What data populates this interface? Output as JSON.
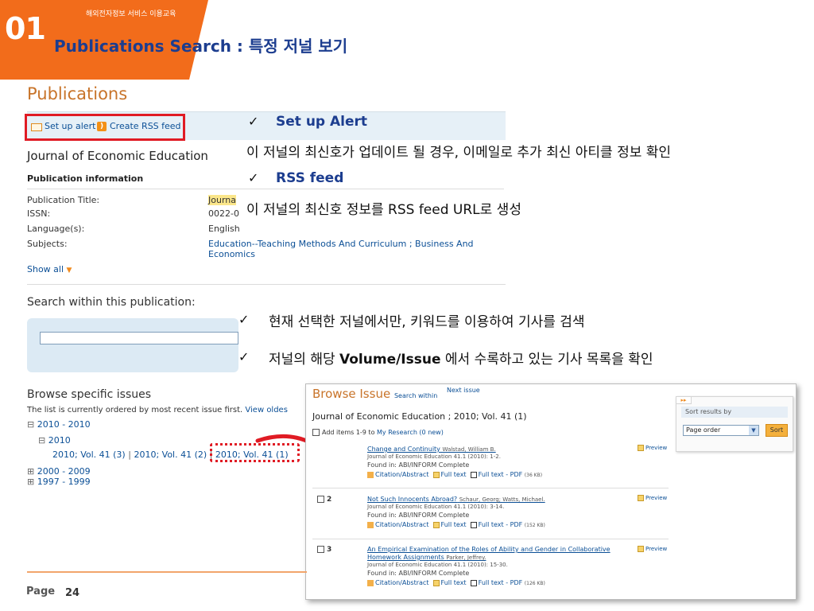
{
  "slide": {
    "section_number": "01",
    "section_small": "해외전자정보 서비스 이용교육",
    "title": "Publications Search : 특정 저널 보기",
    "page_label": "Page",
    "page_number": "24",
    "accent_color": "#f26c1b",
    "title_color": "#1c3d8f"
  },
  "publications": {
    "heading": "Publications",
    "toolbar": {
      "alert_label": "Set up alert",
      "rss_label": "Create RSS feed"
    },
    "journal_title": "Journal of Economic Education",
    "info_heading": "Publication information",
    "info": [
      {
        "label": "Publication Title:",
        "value": "Journa"
      },
      {
        "label": "ISSN:",
        "value": "0022-0"
      },
      {
        "label": "Language(s):",
        "value": "English"
      },
      {
        "label": "Subjects:",
        "value": "Education--Teaching Methods And Curriculum ; Business And Economics"
      }
    ],
    "show_all": "Show all",
    "search_heading": "Search within this publication:",
    "browse_heading": "Browse specific issues",
    "order_text": "The list is currently ordered by most recent issue first.",
    "order_link": "View oldes",
    "tree": {
      "range_2010": "2010 - 2010",
      "year_2010": "2010",
      "issue_a": "2010; Vol. 41 (3)",
      "issue_b": "2010; Vol. 41 (2)",
      "issue_c": "2010; Vol. 41 (1)",
      "range_2000": "2000 - 2009",
      "range_1997": "1997 - 1999"
    }
  },
  "annotations": {
    "check": "✓",
    "alert_title": "Set up Alert",
    "alert_desc": "이 저널의 최신호가 업데이트 될 경우, 이메일로 추가 최신 아티클 정보 확인",
    "rss_title": "RSS feed",
    "rss_desc": "이 저널의 최신호 정보를 RSS feed URL로 생성",
    "search_note": "현재 선택한 저널에서만, 키워드를 이용하여 기사를 검색",
    "volume_note_pre": "저널의 해당 ",
    "volume_note_bold": "Volume/Issue",
    "volume_note_post": " 에서 수록하고 있는 기사 목록을 확인"
  },
  "browse_issue": {
    "title": "Browse Issue",
    "search_within": "Search within",
    "next_issue": "Next issue",
    "journal_line": "Journal of Economic Education ; 2010; Vol. 41 (1)",
    "add_items_pre": "Add items 1-9 to",
    "add_items_link": "My Research (0 new)",
    "preview_label": "Preview",
    "found_in": "Found in: ABI/INFORM Complete",
    "citation_label": "Citation/Abstract",
    "fulltext_label": "Full text",
    "pdf_label": "Full text - PDF",
    "articles": [
      {
        "num": "",
        "title": "Change and Continuity",
        "author": "Walstad, William B.",
        "source": "Journal of Economic Education 41.1 (2010): 1-2.",
        "pdf_size": "(36 KB)"
      },
      {
        "num": "2",
        "title": "Not Such Innocents Abroad?",
        "author": "Schaur, Georg; Watts, Michael.",
        "source": "Journal of Economic Education 41.1 (2010): 3-14.",
        "pdf_size": "(152 KB)"
      },
      {
        "num": "3",
        "title": "An Empirical Examination of the Roles of Ability and Gender in Collaborative Homework Assignments",
        "author": "Parker, Jeffrey.",
        "source": "Journal of Economic Education 41.1 (2010): 15-30.",
        "pdf_size": "(126 KB)"
      }
    ],
    "sort": {
      "heading": "Sort results by",
      "selected": "Page order",
      "button": "Sort"
    }
  }
}
